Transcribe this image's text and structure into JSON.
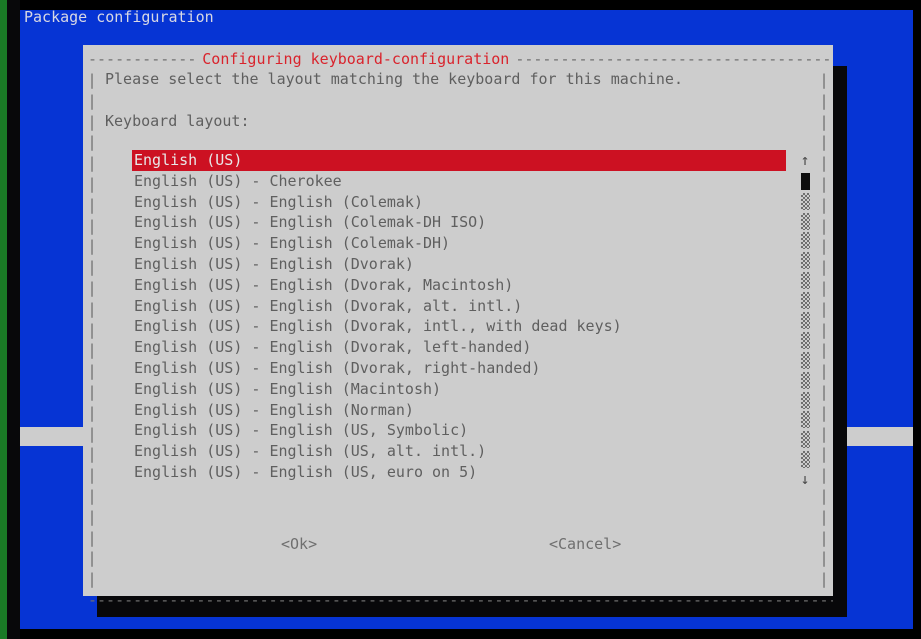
{
  "screen": {
    "status_line": "Package configuration",
    "colors": {
      "background_blue": "#0634d4",
      "dialog_grey": "#cdcdcd",
      "title_red": "#d9232c",
      "highlight_red": "#cc1122",
      "shadow_black": "#08080a",
      "edge_green": "#1a7a26",
      "text_grey": "#5f5f5f"
    }
  },
  "dialog": {
    "title": "Configuring keyboard-configuration",
    "rule_left": "-----------------",
    "rule_right": "----------------------------------------------------------------",
    "bottom_rule": "-------------------------------------------------------------------------------------",
    "side_bar_chars": "|\n|\n|\n|\n|\n|\n|\n|\n|\n|\n|\n|\n|\n|\n|\n|\n|\n|\n|\n|\n|\n|\n|\n|\n|",
    "prompt": "Please select the layout matching the keyboard for this machine.",
    "field_label": "Keyboard layout:",
    "buttons": {
      "ok": "<Ok>",
      "cancel": "<Cancel>"
    }
  },
  "list": {
    "selected_index": 0,
    "items": [
      "English (US)",
      "English (US) - Cherokee",
      "English (US) - English (Colemak)",
      "English (US) - English (Colemak-DH ISO)",
      "English (US) - English (Colemak-DH)",
      "English (US) - English (Dvorak)",
      "English (US) - English (Dvorak, Macintosh)",
      "English (US) - English (Dvorak, alt. intl.)",
      "English (US) - English (Dvorak, intl., with dead keys)",
      "English (US) - English (Dvorak, left-handed)",
      "English (US) - English (Dvorak, right-handed)",
      "English (US) - English (Macintosh)",
      "English (US) - English (Norman)",
      "English (US) - English (US, Symbolic)",
      "English (US) - English (US, alt. intl.)",
      "English (US) - English (US, euro on 5)"
    ]
  },
  "scrollbar": {
    "up_arrow": "↑",
    "down_arrow": "↓",
    "cells": [
      "up",
      "thumb",
      "track",
      "track",
      "track",
      "track",
      "track",
      "track",
      "track",
      "track",
      "track",
      "track",
      "track",
      "track",
      "track",
      "track",
      "down"
    ]
  }
}
